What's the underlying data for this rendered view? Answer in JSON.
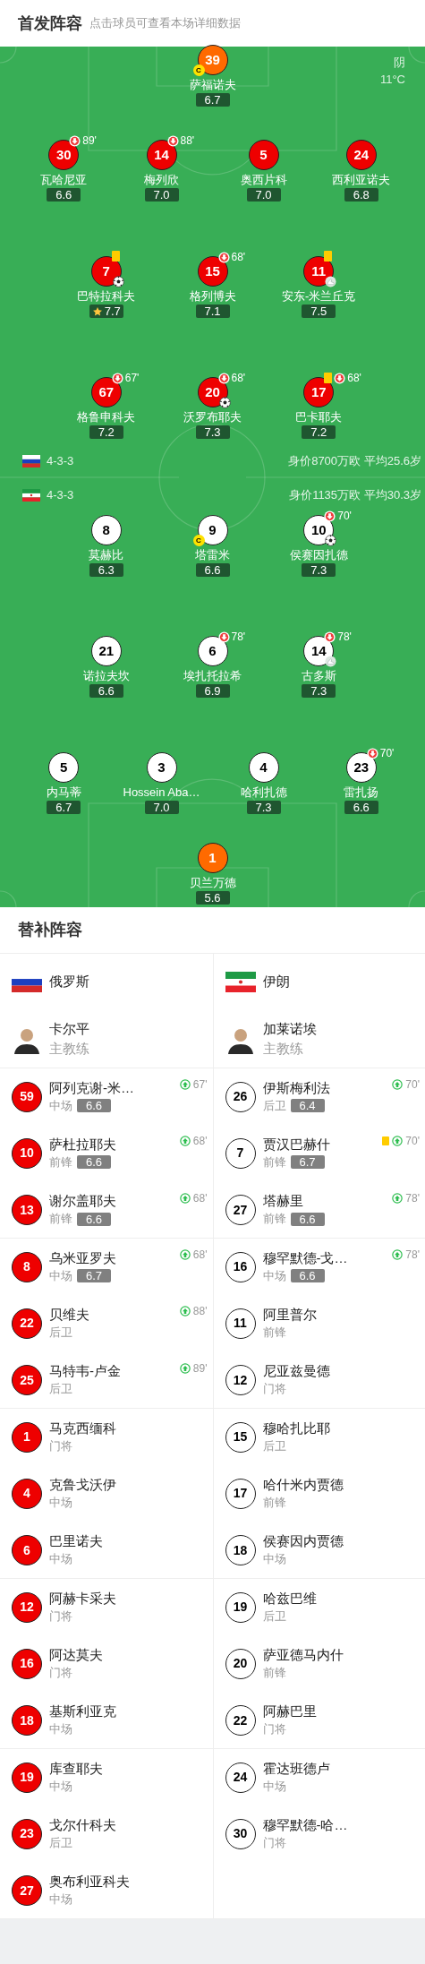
{
  "header": {
    "title": "首发阵容",
    "subtitle": "点击球员可查看本场详细数据"
  },
  "pitch": {
    "weather": "阴",
    "temperature": "11°C"
  },
  "subs_title": "替补阵容",
  "teams": [
    {
      "name": "俄罗斯",
      "kind": "russia",
      "color": "#ee0000",
      "formation": "4-3-3",
      "value_age": "身价8700万欧 平均25.6岁",
      "lineup": [
        [
          {
            "number": "39",
            "name": "萨福诺夫",
            "rating": "6.7",
            "kind": "goalkeeper",
            "badges": [
              {
                "kind": "captain",
                "text": "C"
              }
            ]
          }
        ],
        [
          {
            "number": "30",
            "name": "瓦哈尼亚",
            "rating": "6.6",
            "kind": "outfield",
            "badges": [
              {
                "kind": "sub_off",
                "minute": "89'"
              }
            ]
          },
          {
            "number": "14",
            "name": "梅列欣",
            "rating": "7.0",
            "kind": "outfield",
            "badges": [
              {
                "kind": "sub_off",
                "minute": "88'"
              }
            ]
          },
          {
            "number": "5",
            "name": "奥西片科",
            "rating": "7.0",
            "kind": "outfield"
          },
          {
            "number": "24",
            "name": "西利亚诺夫",
            "rating": "6.8",
            "kind": "outfield"
          }
        ],
        [
          {
            "number": "7",
            "name": "巴特拉科夫",
            "rating": "7.7",
            "kind": "outfield",
            "badges": [
              {
                "kind": "yellow_card"
              },
              {
                "kind": "goal"
              },
              {
                "kind": "best"
              }
            ]
          },
          {
            "number": "15",
            "name": "格列博夫",
            "rating": "7.1",
            "kind": "outfield",
            "badges": [
              {
                "kind": "sub_off",
                "minute": "68'"
              }
            ]
          },
          {
            "number": "11",
            "name": "安东-米兰丘克",
            "rating": "7.5",
            "kind": "outfield",
            "badges": [
              {
                "kind": "yellow_card"
              },
              {
                "kind": "assist"
              }
            ]
          }
        ],
        [
          {
            "number": "67",
            "name": "格鲁申科夫",
            "rating": "7.2",
            "kind": "outfield",
            "badges": [
              {
                "kind": "sub_off",
                "minute": "67'"
              }
            ]
          },
          {
            "number": "20",
            "name": "沃罗布耶夫",
            "rating": "7.3",
            "kind": "outfield",
            "badges": [
              {
                "kind": "sub_off",
                "minute": "68'"
              },
              {
                "kind": "goal"
              }
            ]
          },
          {
            "number": "17",
            "name": "巴卡耶夫",
            "rating": "7.2",
            "kind": "outfield",
            "badges": [
              {
                "kind": "yellow_card"
              },
              {
                "kind": "sub_off",
                "minute": "68'"
              }
            ]
          }
        ]
      ],
      "coach": {
        "name": "卡尔平",
        "role": "主教练"
      },
      "subs": [
        {
          "number": "59",
          "name": "阿列克谢-米…",
          "position": "中场",
          "rating": "6.6",
          "sub_in": "67'",
          "yellow_card": false
        },
        {
          "number": "10",
          "name": "萨杜拉耶夫",
          "position": "前锋",
          "rating": "6.6",
          "sub_in": "68'",
          "yellow_card": false
        },
        {
          "number": "13",
          "name": "谢尔盖耶夫",
          "position": "前锋",
          "rating": "6.6",
          "sub_in": "68'",
          "yellow_card": false
        },
        {
          "number": "8",
          "name": "乌米亚罗夫",
          "position": "中场",
          "rating": "6.7",
          "sub_in": "68'",
          "yellow_card": false
        },
        {
          "number": "22",
          "name": "贝维夫",
          "position": "后卫",
          "sub_in": "88'",
          "yellow_card": false
        },
        {
          "number": "25",
          "name": "马特韦-卢金",
          "position": "后卫",
          "sub_in": "89'",
          "yellow_card": false
        },
        {
          "number": "1",
          "name": "马克西缅科",
          "position": "门将",
          "yellow_card": false
        },
        {
          "number": "4",
          "name": "克鲁戈沃伊",
          "position": "中场",
          "yellow_card": false
        },
        {
          "number": "6",
          "name": "巴里诺夫",
          "position": "中场",
          "yellow_card": false
        },
        {
          "number": "12",
          "name": "阿赫卡采夫",
          "position": "门将",
          "yellow_card": false
        },
        {
          "number": "16",
          "name": "阿达莫夫",
          "position": "门将",
          "yellow_card": false
        },
        {
          "number": "18",
          "name": "基斯利亚克",
          "position": "中场",
          "yellow_card": false
        },
        {
          "number": "19",
          "name": "库查耶夫",
          "position": "中场",
          "yellow_card": false
        },
        {
          "number": "23",
          "name": "戈尔什科夫",
          "position": "后卫",
          "yellow_card": false
        },
        {
          "number": "27",
          "name": "奥布利亚科夫",
          "position": "中场",
          "yellow_card": false
        }
      ]
    },
    {
      "name": "伊朗",
      "kind": "iran",
      "color": "#ffffff",
      "formation": "4-3-3",
      "value_age": "身价1135万欧 平均30.3岁",
      "lineup": [
        [
          {
            "number": "8",
            "name": "莫赫比",
            "rating": "6.3",
            "kind": "outfield"
          },
          {
            "number": "9",
            "name": "塔雷米",
            "rating": "6.6",
            "kind": "outfield",
            "badges": [
              {
                "kind": "captain",
                "text": "C"
              }
            ]
          },
          {
            "number": "10",
            "name": "侯赛因扎德",
            "rating": "7.3",
            "kind": "outfield",
            "badges": [
              {
                "kind": "sub_off",
                "minute": "70'"
              },
              {
                "kind": "goal"
              }
            ]
          }
        ],
        [
          {
            "number": "21",
            "name": "诺拉夫坎",
            "rating": "6.6",
            "kind": "outfield"
          },
          {
            "number": "6",
            "name": "埃扎托拉希",
            "rating": "6.9",
            "kind": "outfield",
            "badges": [
              {
                "kind": "sub_off",
                "minute": "78'"
              }
            ]
          },
          {
            "number": "14",
            "name": "古多斯",
            "rating": "7.3",
            "kind": "outfield",
            "badges": [
              {
                "kind": "sub_off",
                "minute": "78'"
              },
              {
                "kind": "assist"
              }
            ]
          }
        ],
        [
          {
            "number": "5",
            "name": "内马蒂",
            "rating": "6.7",
            "kind": "outfield"
          },
          {
            "number": "3",
            "name": "Hossein Aba…",
            "rating": "7.0",
            "kind": "outfield"
          },
          {
            "number": "4",
            "name": "哈利扎德",
            "rating": "7.3",
            "kind": "outfield"
          },
          {
            "number": "23",
            "name": "雷扎扬",
            "rating": "6.6",
            "kind": "outfield",
            "badges": [
              {
                "kind": "sub_off",
                "minute": "70'"
              }
            ]
          }
        ],
        [
          {
            "number": "1",
            "name": "贝兰万德",
            "rating": "5.6",
            "kind": "goalkeeper"
          }
        ]
      ],
      "coach": {
        "name": "加莱诺埃",
        "role": "主教练"
      },
      "subs": [
        {
          "number": "26",
          "name": "伊斯梅利法",
          "position": "后卫",
          "rating": "6.4",
          "sub_in": "70'",
          "yellow_card": false
        },
        {
          "number": "7",
          "name": "贾汉巴赫什",
          "position": "前锋",
          "rating": "6.7",
          "sub_in": "70'",
          "yellow_card": true
        },
        {
          "number": "27",
          "name": "塔赫里",
          "position": "前锋",
          "rating": "6.6",
          "sub_in": "78'",
          "yellow_card": false
        },
        {
          "number": "16",
          "name": "穆罕默德-戈…",
          "position": "中场",
          "rating": "6.6",
          "sub_in": "78'",
          "yellow_card": false
        },
        {
          "number": "11",
          "name": "阿里普尔",
          "position": "前锋",
          "yellow_card": false
        },
        {
          "number": "12",
          "name": "尼亚兹曼德",
          "position": "门将",
          "yellow_card": false
        },
        {
          "number": "15",
          "name": "穆哈扎比耶",
          "position": "后卫",
          "yellow_card": false
        },
        {
          "number": "17",
          "name": "哈什米内贾德",
          "position": "前锋",
          "yellow_card": false
        },
        {
          "number": "18",
          "name": "侯赛因内贾德",
          "position": "中场",
          "yellow_card": false
        },
        {
          "number": "19",
          "name": "哈兹巴维",
          "position": "后卫",
          "yellow_card": false
        },
        {
          "number": "20",
          "name": "萨亚德马内什",
          "position": "前锋",
          "yellow_card": false
        },
        {
          "number": "22",
          "name": "阿赫巴里",
          "position": "门将",
          "yellow_card": false
        },
        {
          "number": "24",
          "name": "霍达班德卢",
          "position": "中场",
          "yellow_card": false
        },
        {
          "number": "30",
          "name": "穆罕默德-哈…",
          "position": "门将",
          "yellow_card": false
        }
      ]
    }
  ]
}
